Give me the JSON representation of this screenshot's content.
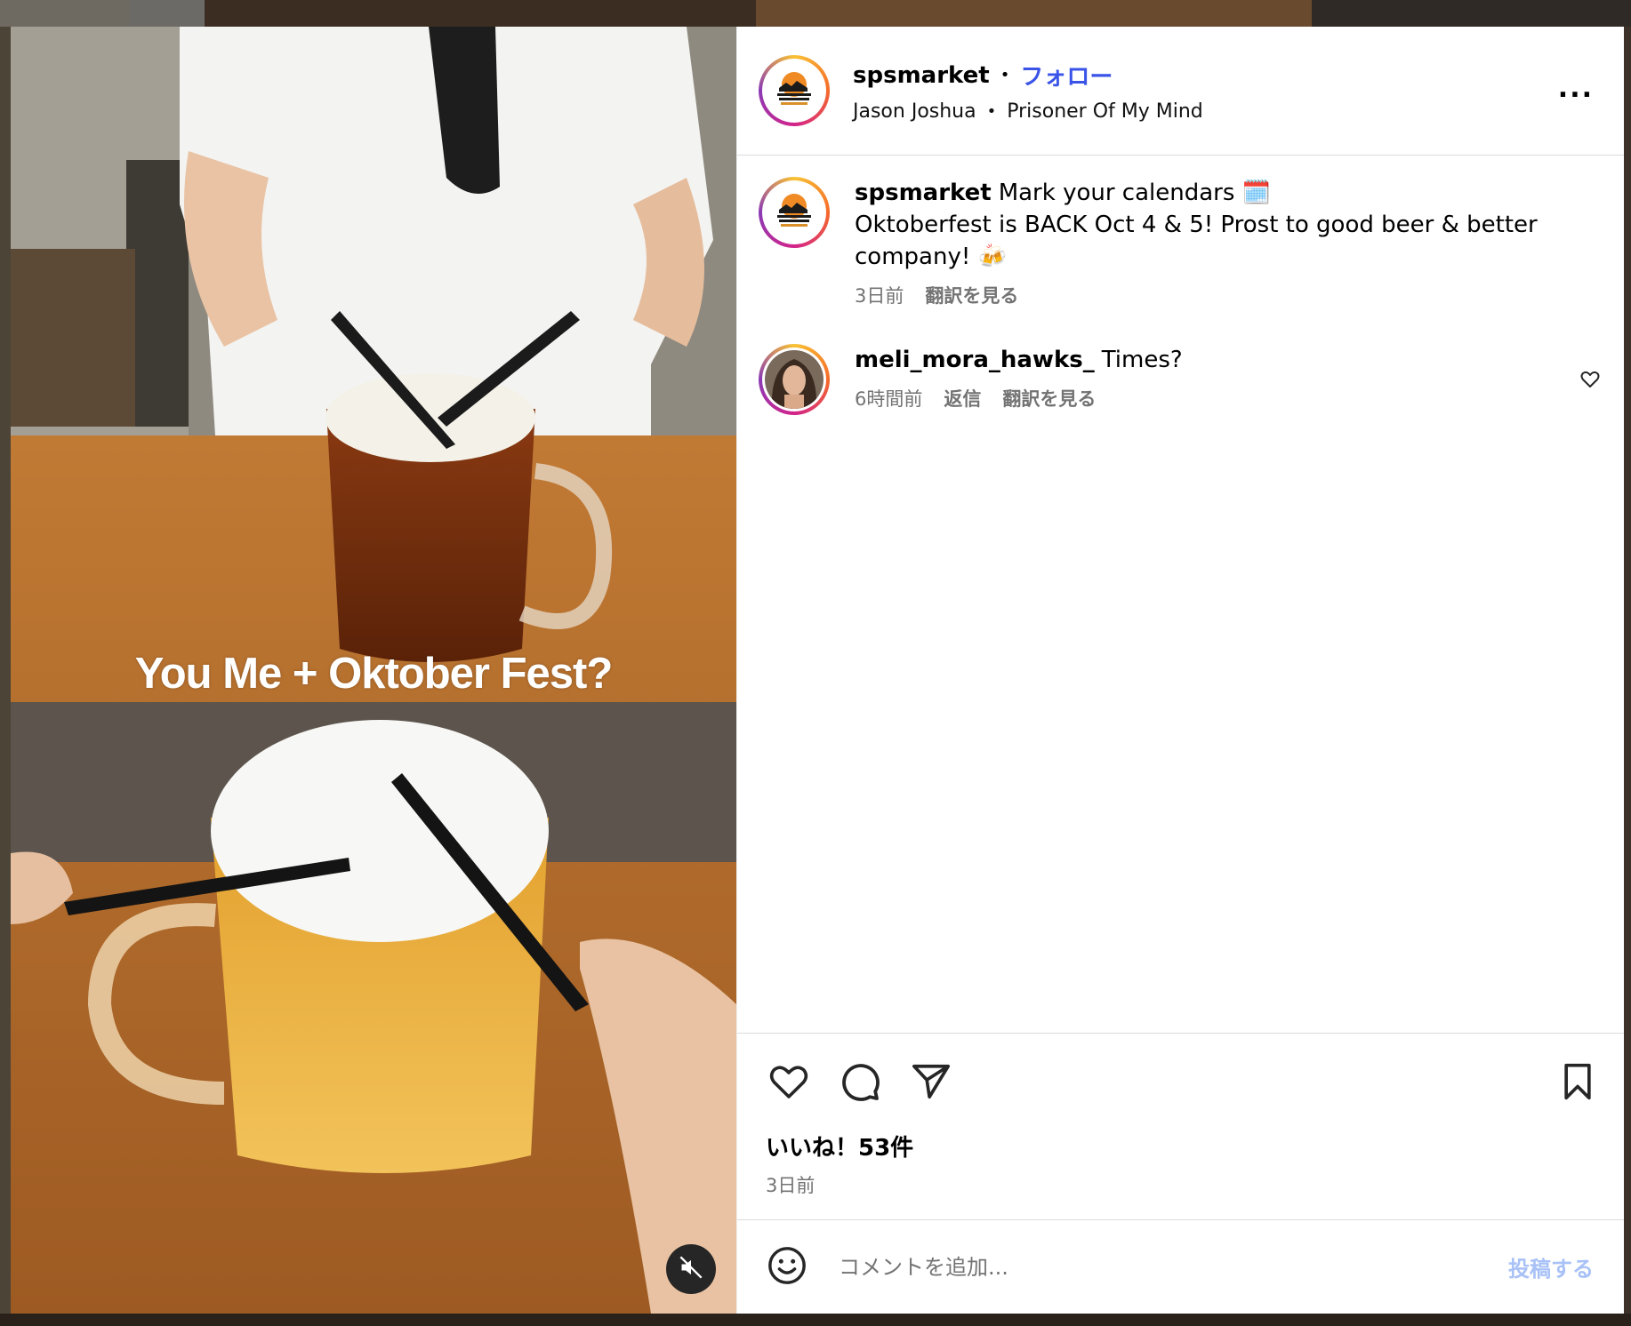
{
  "colors": {
    "follow_blue": "#3a54e8",
    "post_button_disabled": "#a8c1f7",
    "meta_gray": "#737373"
  },
  "media": {
    "overlay_text": "You Me + Oktober Fest?",
    "mute_icon": "speaker-muted-icon"
  },
  "header": {
    "username": "spsmarket",
    "separator": "•",
    "follow_label": "フォロー",
    "audio_artist": "Jason Joshua",
    "audio_title": "Prisoner Of My Mind",
    "more_icon": "more-horizontal-icon",
    "more_label": "..."
  },
  "caption": {
    "username": "spsmarket",
    "text_line1": "Mark your calendars 🗓️",
    "text_line2": "Oktoberfest is BACK Oct 4 & 5! Prost to good beer & better company! 🍻",
    "time": "3日前",
    "translate": "翻訳を見る"
  },
  "comments": [
    {
      "username": "meli_mora_hawks_",
      "text": "Times?",
      "time": "6時間前",
      "reply": "返信",
      "translate": "翻訳を見る",
      "like_icon": "heart-outline-icon"
    }
  ],
  "actions": {
    "like_icon": "heart-outline-icon",
    "comment_icon": "speech-bubble-icon",
    "share_icon": "paper-plane-icon",
    "save_icon": "bookmark-icon"
  },
  "likes": "いいね！53件",
  "post_date": "3日前",
  "comment_box": {
    "emoji_icon": "smiley-icon",
    "placeholder": "コメントを追加...",
    "post_label": "投稿する"
  }
}
